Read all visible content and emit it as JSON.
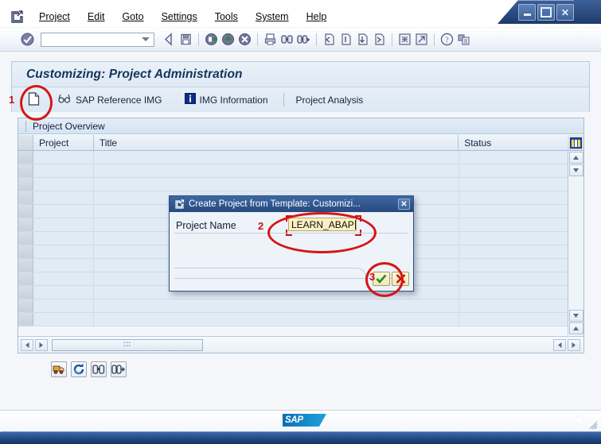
{
  "window": {
    "controls": [
      {
        "name": "minimize",
        "glyph": "_"
      },
      {
        "name": "maximize",
        "glyph": "□"
      },
      {
        "name": "close",
        "glyph": "✕"
      }
    ]
  },
  "menubar": {
    "system_icon": "session-icon",
    "items": [
      {
        "label": "Project",
        "accel": "P"
      },
      {
        "label": "Edit",
        "accel": "E"
      },
      {
        "label": "Goto",
        "accel": "G"
      },
      {
        "label": "Settings",
        "accel": "S"
      },
      {
        "label": "Tools",
        "accel": "T"
      },
      {
        "label": "System",
        "accel": "y"
      },
      {
        "label": "Help",
        "accel": "H"
      }
    ]
  },
  "toolbar": {
    "enter_icon": "enter-check-icon",
    "command_field": {
      "value": "",
      "placeholder": ""
    },
    "icons": [
      "back-icon",
      "save-icon",
      "sep",
      "exit-icon",
      "up-icon",
      "cancel-icon",
      "sep",
      "print-icon",
      "find-icon",
      "find-next-icon",
      "sep",
      "first-page-icon",
      "previous-page-icon",
      "next-page-icon",
      "last-page-icon",
      "sep",
      "create-session-icon",
      "create-shortcut-icon",
      "sep",
      "help-icon",
      "customize-local-layout-icon"
    ]
  },
  "screen": {
    "title": "Customizing: Project Administration",
    "app_toolbar": [
      {
        "name": "create-project-button",
        "icon": "document-new-icon",
        "label": ""
      },
      {
        "name": "sap-reference-img-button",
        "icon": "glasses-icon",
        "label": "SAP Reference IMG"
      },
      {
        "name": "img-information-button",
        "icon": "info-blue-icon",
        "label": "IMG Information"
      },
      {
        "name": "separator",
        "icon": "",
        "label": ""
      },
      {
        "name": "project-analysis-button",
        "icon": "",
        "label": "Project Analysis"
      }
    ]
  },
  "table": {
    "panel_title": "Project Overview",
    "columns": [
      "Project",
      "Title",
      "Status"
    ],
    "rows": [],
    "empty_row_count": 13,
    "config_icon": "column-settings-icon",
    "vscroll": {
      "up": "▲",
      "down": "▼"
    },
    "hscroll": {
      "left": "◀",
      "right": "▶"
    }
  },
  "bottom_icons": [
    {
      "name": "transport-icon",
      "glyph": "truck"
    },
    {
      "name": "refresh-icon",
      "glyph": "refresh"
    },
    {
      "name": "find-icon",
      "glyph": "binoculars"
    },
    {
      "name": "find-next-icon",
      "glyph": "binoculars-plus"
    }
  ],
  "statusbar": {
    "logo": "SAP",
    "expand_icon": "collapse-arrow-icon"
  },
  "dialog": {
    "title": "Create Project from Template: Customizi...",
    "title_icon": "session-icon",
    "close_glyph": "✕",
    "field_label": "Project Name",
    "field_value": "LEARN_ABAP",
    "ok_button": {
      "name": "continue-button",
      "glyph": "✔"
    },
    "cancel_button": {
      "name": "cancel-button",
      "glyph": "✘"
    }
  },
  "annotations": [
    {
      "id": "1",
      "target": "create-project-button"
    },
    {
      "id": "2",
      "target": "project-name-input"
    },
    {
      "id": "3",
      "target": "continue-button"
    }
  ],
  "colors": {
    "accent_blue": "#27497e",
    "annotation_red": "#d51616",
    "input_yellow": "#fbf0c2",
    "grid_cell": "#e1ebf5",
    "sap_logo_blue": "#0a6eb4"
  }
}
